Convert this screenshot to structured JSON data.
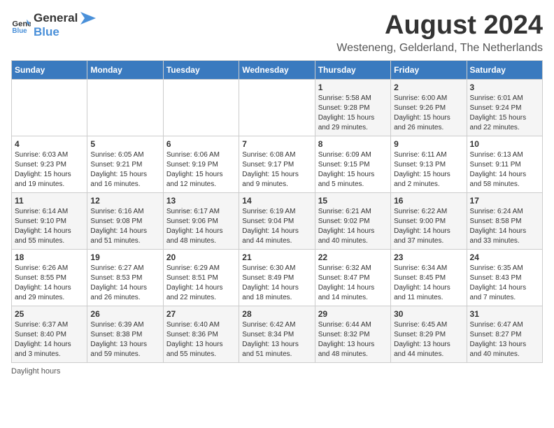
{
  "logo": {
    "line1": "General",
    "line2": "Blue"
  },
  "title": "August 2024",
  "subtitle": "Westeneng, Gelderland, The Netherlands",
  "days_of_week": [
    "Sunday",
    "Monday",
    "Tuesday",
    "Wednesday",
    "Thursday",
    "Friday",
    "Saturday"
  ],
  "weeks": [
    [
      {
        "day": "",
        "info": ""
      },
      {
        "day": "",
        "info": ""
      },
      {
        "day": "",
        "info": ""
      },
      {
        "day": "",
        "info": ""
      },
      {
        "day": "1",
        "info": "Sunrise: 5:58 AM\nSunset: 9:28 PM\nDaylight: 15 hours\nand 29 minutes."
      },
      {
        "day": "2",
        "info": "Sunrise: 6:00 AM\nSunset: 9:26 PM\nDaylight: 15 hours\nand 26 minutes."
      },
      {
        "day": "3",
        "info": "Sunrise: 6:01 AM\nSunset: 9:24 PM\nDaylight: 15 hours\nand 22 minutes."
      }
    ],
    [
      {
        "day": "4",
        "info": "Sunrise: 6:03 AM\nSunset: 9:23 PM\nDaylight: 15 hours\nand 19 minutes."
      },
      {
        "day": "5",
        "info": "Sunrise: 6:05 AM\nSunset: 9:21 PM\nDaylight: 15 hours\nand 16 minutes."
      },
      {
        "day": "6",
        "info": "Sunrise: 6:06 AM\nSunset: 9:19 PM\nDaylight: 15 hours\nand 12 minutes."
      },
      {
        "day": "7",
        "info": "Sunrise: 6:08 AM\nSunset: 9:17 PM\nDaylight: 15 hours\nand 9 minutes."
      },
      {
        "day": "8",
        "info": "Sunrise: 6:09 AM\nSunset: 9:15 PM\nDaylight: 15 hours\nand 5 minutes."
      },
      {
        "day": "9",
        "info": "Sunrise: 6:11 AM\nSunset: 9:13 PM\nDaylight: 15 hours\nand 2 minutes."
      },
      {
        "day": "10",
        "info": "Sunrise: 6:13 AM\nSunset: 9:11 PM\nDaylight: 14 hours\nand 58 minutes."
      }
    ],
    [
      {
        "day": "11",
        "info": "Sunrise: 6:14 AM\nSunset: 9:10 PM\nDaylight: 14 hours\nand 55 minutes."
      },
      {
        "day": "12",
        "info": "Sunrise: 6:16 AM\nSunset: 9:08 PM\nDaylight: 14 hours\nand 51 minutes."
      },
      {
        "day": "13",
        "info": "Sunrise: 6:17 AM\nSunset: 9:06 PM\nDaylight: 14 hours\nand 48 minutes."
      },
      {
        "day": "14",
        "info": "Sunrise: 6:19 AM\nSunset: 9:04 PM\nDaylight: 14 hours\nand 44 minutes."
      },
      {
        "day": "15",
        "info": "Sunrise: 6:21 AM\nSunset: 9:02 PM\nDaylight: 14 hours\nand 40 minutes."
      },
      {
        "day": "16",
        "info": "Sunrise: 6:22 AM\nSunset: 9:00 PM\nDaylight: 14 hours\nand 37 minutes."
      },
      {
        "day": "17",
        "info": "Sunrise: 6:24 AM\nSunset: 8:58 PM\nDaylight: 14 hours\nand 33 minutes."
      }
    ],
    [
      {
        "day": "18",
        "info": "Sunrise: 6:26 AM\nSunset: 8:55 PM\nDaylight: 14 hours\nand 29 minutes."
      },
      {
        "day": "19",
        "info": "Sunrise: 6:27 AM\nSunset: 8:53 PM\nDaylight: 14 hours\nand 26 minutes."
      },
      {
        "day": "20",
        "info": "Sunrise: 6:29 AM\nSunset: 8:51 PM\nDaylight: 14 hours\nand 22 minutes."
      },
      {
        "day": "21",
        "info": "Sunrise: 6:30 AM\nSunset: 8:49 PM\nDaylight: 14 hours\nand 18 minutes."
      },
      {
        "day": "22",
        "info": "Sunrise: 6:32 AM\nSunset: 8:47 PM\nDaylight: 14 hours\nand 14 minutes."
      },
      {
        "day": "23",
        "info": "Sunrise: 6:34 AM\nSunset: 8:45 PM\nDaylight: 14 hours\nand 11 minutes."
      },
      {
        "day": "24",
        "info": "Sunrise: 6:35 AM\nSunset: 8:43 PM\nDaylight: 14 hours\nand 7 minutes."
      }
    ],
    [
      {
        "day": "25",
        "info": "Sunrise: 6:37 AM\nSunset: 8:40 PM\nDaylight: 14 hours\nand 3 minutes."
      },
      {
        "day": "26",
        "info": "Sunrise: 6:39 AM\nSunset: 8:38 PM\nDaylight: 13 hours\nand 59 minutes."
      },
      {
        "day": "27",
        "info": "Sunrise: 6:40 AM\nSunset: 8:36 PM\nDaylight: 13 hours\nand 55 minutes."
      },
      {
        "day": "28",
        "info": "Sunrise: 6:42 AM\nSunset: 8:34 PM\nDaylight: 13 hours\nand 51 minutes."
      },
      {
        "day": "29",
        "info": "Sunrise: 6:44 AM\nSunset: 8:32 PM\nDaylight: 13 hours\nand 48 minutes."
      },
      {
        "day": "30",
        "info": "Sunrise: 6:45 AM\nSunset: 8:29 PM\nDaylight: 13 hours\nand 44 minutes."
      },
      {
        "day": "31",
        "info": "Sunrise: 6:47 AM\nSunset: 8:27 PM\nDaylight: 13 hours\nand 40 minutes."
      }
    ]
  ],
  "footer": {
    "daylight_label": "Daylight hours"
  }
}
